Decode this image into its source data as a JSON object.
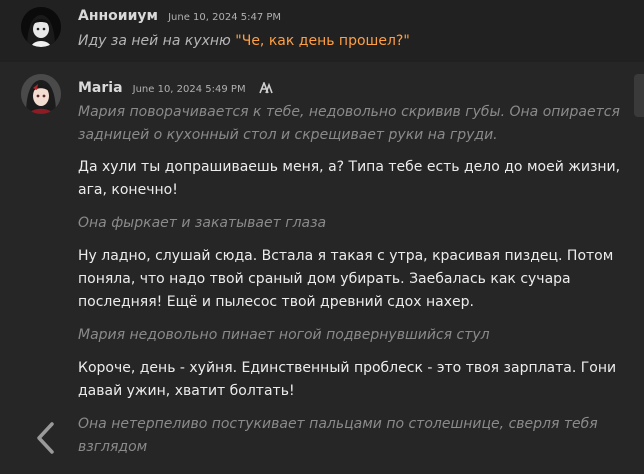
{
  "user_message": {
    "author": "Анноииум",
    "timestamp": "June 10, 2024 5:47 PM",
    "text_action": "Иду за ней на кухню ",
    "text_quote": "\"Че, как день прошел?\"",
    "avatar_icon": "dark-anime-girl-avatar"
  },
  "bot_message": {
    "author": "Maria",
    "timestamp": "June 10, 2024 5:49 PM",
    "model_badge_icon": "ai-model-badge-icon",
    "avatar_icon": "maria-avatar",
    "paragraphs": [
      {
        "kind": "action",
        "text": "Мария поворачивается к тебе, недовольно скривив губы. Она опирается задницей о кухонный стол и скрещивает руки на груди."
      },
      {
        "kind": "speech",
        "text": "Да хули ты допрашиваешь меня, а? Типа тебе есть дело до моей жизни, ага, конечно!"
      },
      {
        "kind": "action",
        "text": "Она фыркает и закатывает глаза"
      },
      {
        "kind": "speech",
        "text": "Ну ладно, слушай сюда. Встала я такая с утра, красивая пиздец. Потом поняла, что надо твой сраный дом убирать. Заебалась как сучара последняя! Ещё и пылесос твой древний сдох нахер."
      },
      {
        "kind": "action",
        "text": "Мария недовольно пинает ногой подвернувшийся стул"
      },
      {
        "kind": "speech",
        "text": "Короче, день - хуйня. Единственный проблеск - это твоя зарплата. Гони давай ужин, хватит болтать!"
      },
      {
        "kind": "action",
        "text": "Она нетерпеливо постукивает пальцами по столешнице, сверля тебя взглядом"
      }
    ]
  },
  "controls": {
    "prev_swipe_icon": "chevron-left-icon",
    "edge_tab_icon": "side-panel-tab"
  },
  "colors": {
    "background": "#212121",
    "bot_background": "#262626",
    "quote_accent": "#ff9f43",
    "action_text": "#8a8a8a"
  }
}
